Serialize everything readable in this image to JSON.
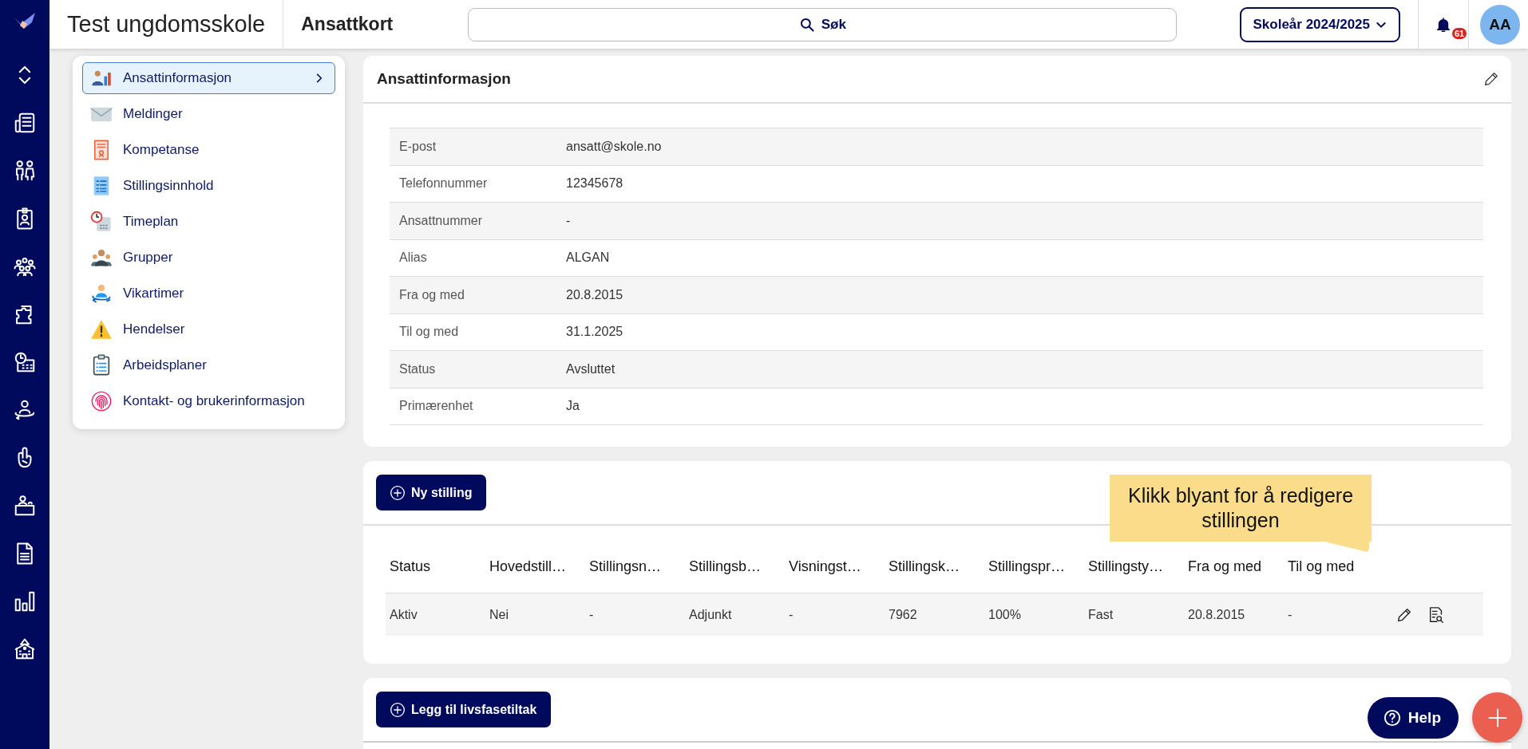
{
  "header": {
    "school": "Test ungdomsskole",
    "page": "Ansattkort",
    "search": "Søk",
    "school_year": "Skoleår 2024/2025",
    "notifications": "61",
    "avatar": "AA"
  },
  "sidebar": {
    "items": [
      {
        "label": "Ansattinformasjon",
        "selected": true
      },
      {
        "label": "Meldinger",
        "selected": false
      },
      {
        "label": "Kompetanse",
        "selected": false
      },
      {
        "label": "Stillingsinnhold",
        "selected": false
      },
      {
        "label": "Timeplan",
        "selected": false
      },
      {
        "label": "Grupper",
        "selected": false
      },
      {
        "label": "Vikartimer",
        "selected": false
      },
      {
        "label": "Hendelser",
        "selected": false
      },
      {
        "label": "Arbeidsplaner",
        "selected": false
      },
      {
        "label": "Kontakt- og brukerinformasjon",
        "selected": false
      }
    ]
  },
  "info": {
    "title": "Ansattinformasjon",
    "rows": [
      {
        "label": "E-post",
        "value": "ansatt@skole.no"
      },
      {
        "label": "Telefonnummer",
        "value": "12345678"
      },
      {
        "label": "Ansattnummer",
        "value": "-"
      },
      {
        "label": "Alias",
        "value": "ALGAN"
      },
      {
        "label": "Fra og med",
        "value": "20.8.2015"
      },
      {
        "label": "Til og med",
        "value": "31.1.2025"
      },
      {
        "label": "Status",
        "value": "Avsluttet"
      },
      {
        "label": "Primærenhet",
        "value": "Ja"
      }
    ]
  },
  "positions": {
    "button": "Ny stilling",
    "tooltip": "Klikk blyant for å redigere stillingen",
    "columns": [
      "Status",
      "Hovedstill…",
      "Stillingsn…",
      "Stillingsb…",
      "Visningst…",
      "Stillingsk…",
      "Stillingspr…",
      "Stillingsty…",
      "Fra og med",
      "Til og med"
    ],
    "rows": [
      {
        "cells": [
          "Aktiv",
          "Nei",
          "-",
          "Adjunkt",
          "-",
          "7962",
          "100%",
          "Fast",
          "20.8.2015",
          "-"
        ]
      }
    ]
  },
  "life_phase": {
    "button": "Legg til livsfasetiltak"
  },
  "help": "Help"
}
